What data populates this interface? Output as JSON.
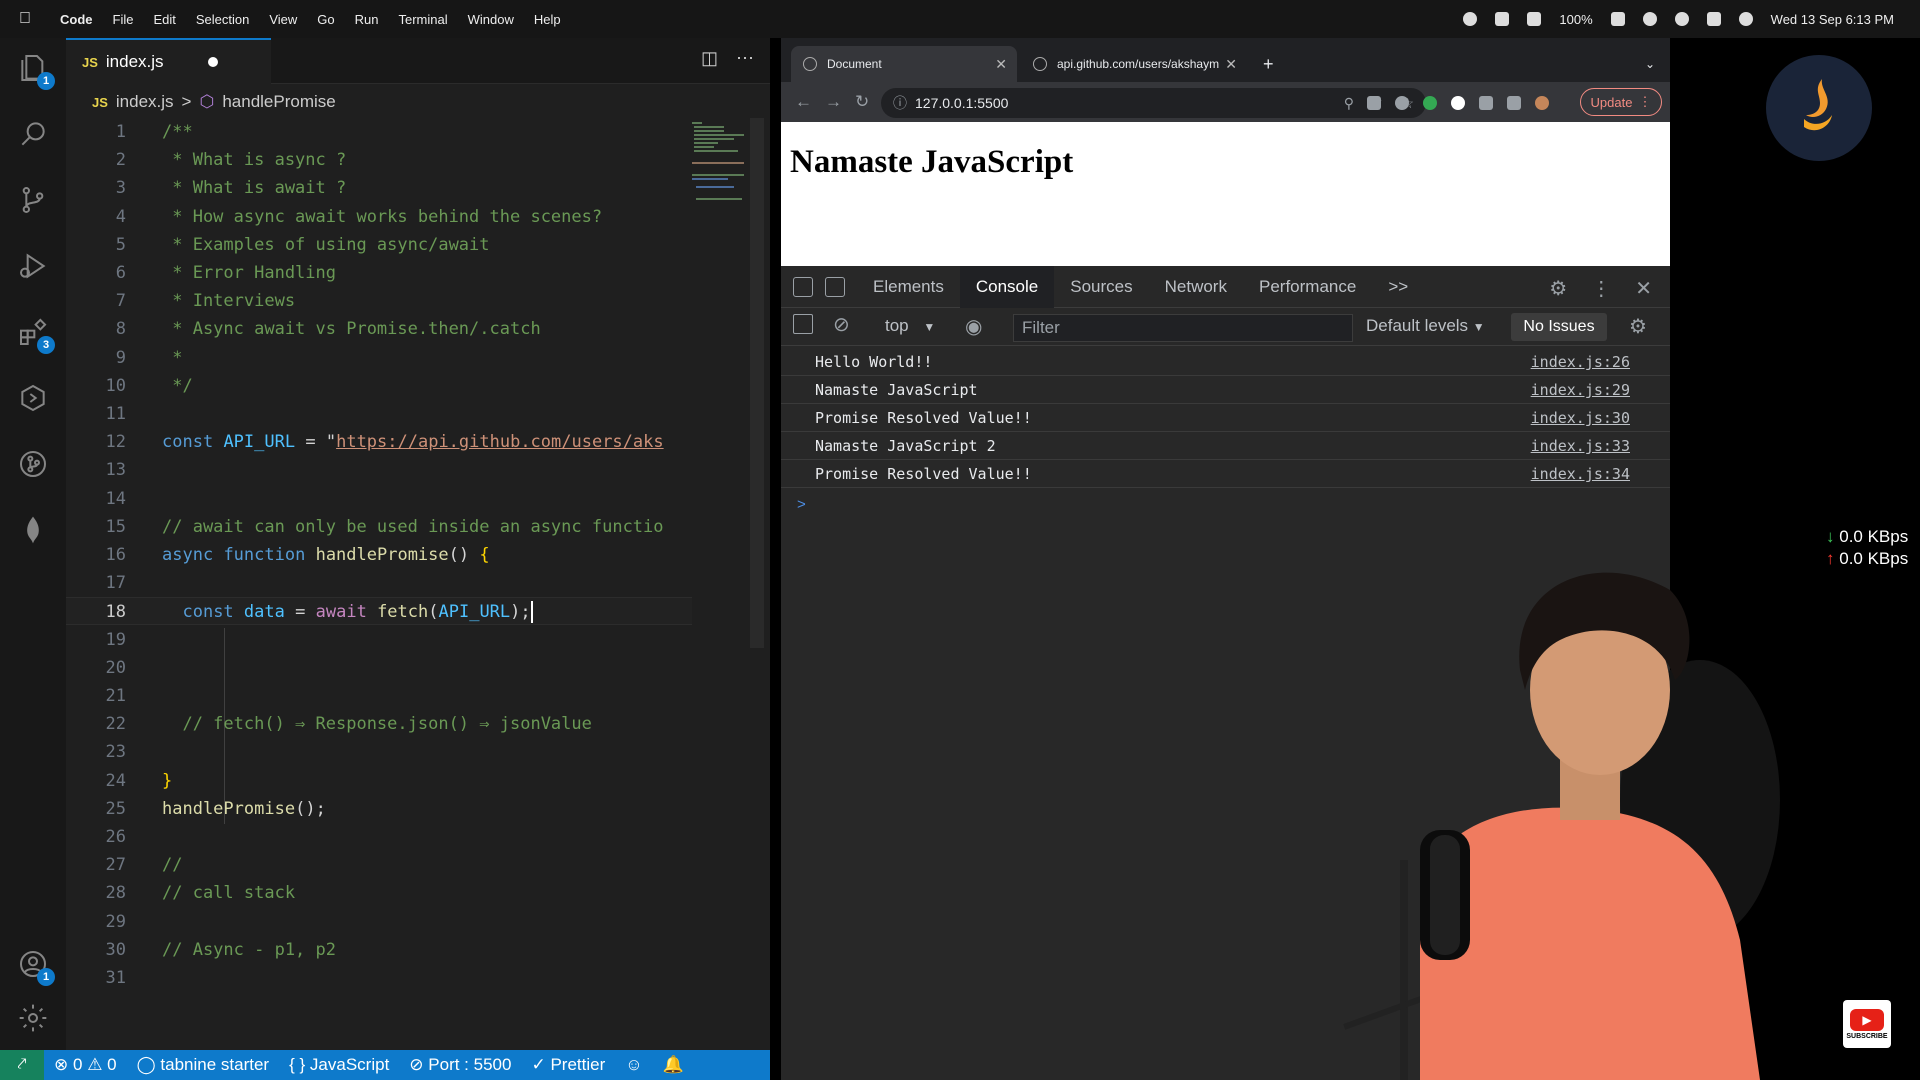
{
  "menubar": {
    "app_name": "Code",
    "items": [
      "File",
      "Edit",
      "Selection",
      "View",
      "Go",
      "Run",
      "Terminal",
      "Window",
      "Help"
    ],
    "battery": "100%",
    "datetime": "Wed 13 Sep 6:13 PM"
  },
  "vscode": {
    "activity_badges": {
      "explorer": "1",
      "extensions": "3",
      "accounts": "1"
    },
    "tab": {
      "lang": "JS",
      "filename": "index.js"
    },
    "breadcrumb": {
      "lang": "JS",
      "file": "index.js",
      "separator": ">",
      "symbol": "handlePromise"
    },
    "code_lines": [
      "/**",
      " * What is async ?",
      " * What is await ?",
      " * How async await works behind the scenes?",
      " * Examples of using async/await",
      " * Error Handling",
      " * Interviews",
      " * Async await vs Promise.then/.catch",
      " *",
      " */",
      "",
      "const API_URL = \"https://api.github.com/users/aks",
      "",
      "",
      "// await can only be used inside an async functio",
      "async function handlePromise() {",
      "",
      "  const data = await fetch(API_URL);",
      "",
      "",
      "",
      "  // fetch() ⇒ Response.json() ⇒ jsonValue",
      "",
      "}",
      "handlePromise();",
      "",
      "//",
      "// call stack",
      "",
      "// Async - p1, p2",
      ""
    ],
    "current_line": 18,
    "statusbar": {
      "errors": "0",
      "warnings": "0",
      "tabnine": "tabnine starter",
      "language": "JavaScript",
      "port": "Port : 5500",
      "prettier": "Prettier"
    }
  },
  "browser": {
    "tabs": [
      {
        "title": "Document",
        "active": true
      },
      {
        "title": "api.github.com/users/akshaym",
        "active": false
      }
    ],
    "url": "127.0.0.1:5500",
    "update_label": "Update",
    "page_heading": "Namaste JavaScript",
    "devtools": {
      "tabs": [
        "Elements",
        "Console",
        "Sources",
        "Network",
        "Performance"
      ],
      "active_tab": "Console",
      "more_tabs": ">>",
      "context": "top",
      "filter_placeholder": "Filter",
      "levels": "Default levels",
      "issues": "No Issues",
      "console_rows": [
        {
          "message": "Hello World!!",
          "source": "index.js:26"
        },
        {
          "message": "Namaste JavaScript",
          "source": "index.js:29"
        },
        {
          "message": "Promise Resolved Value!!",
          "source": "index.js:30"
        },
        {
          "message": "Namaste JavaScript 2",
          "source": "index.js:33"
        },
        {
          "message": "Promise Resolved Value!!",
          "source": "index.js:34"
        }
      ],
      "prompt": ">"
    }
  },
  "overlay": {
    "net_down": "0.0 KBps",
    "net_up": "0.0 KBps",
    "yt_label": "SUBSCRIBE"
  },
  "colors": {
    "vscode_accent": "#0e7acb",
    "remote_green": "#16825d",
    "update_red": "#f28b82"
  }
}
